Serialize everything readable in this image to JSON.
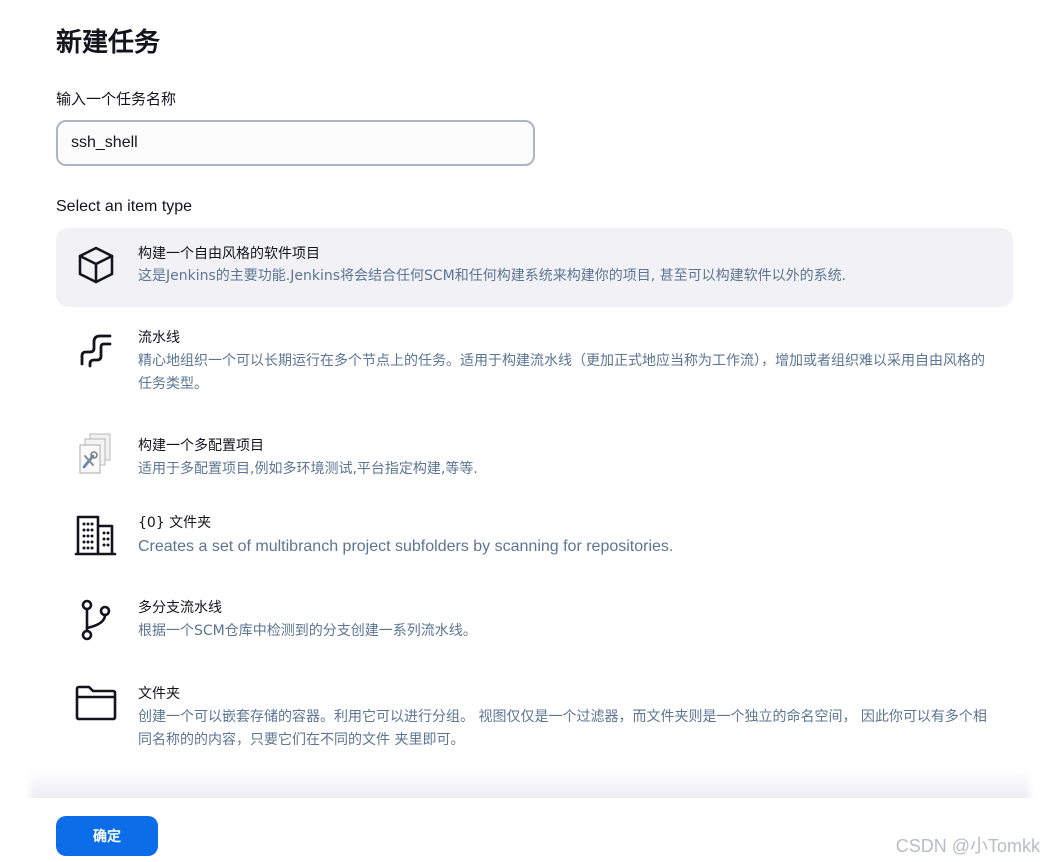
{
  "page": {
    "title": "新建任务"
  },
  "name_field": {
    "label": "输入一个任务名称",
    "value": "ssh_shell"
  },
  "item_types": {
    "label": "Select an item type",
    "items": [
      {
        "icon": "cube-icon",
        "title": "构建一个自由风格的软件项目",
        "description": "这是Jenkins的主要功能.Jenkins将会结合任何SCM和任何构建系统来构建你的项目, 甚至可以构建软件以外的系统.",
        "selected": true
      },
      {
        "icon": "pipeline-icon",
        "title": "流水线",
        "description": "精心地组织一个可以长期运行在多个节点上的任务。适用于构建流水线（更加正式地应当称为工作流），增加或者组织难以采用自由风格的任务类型。",
        "selected": false
      },
      {
        "icon": "multi-config-icon",
        "title": "构建一个多配置项目",
        "description": "适用于多配置项目,例如多环境测试,平台指定构建,等等.",
        "selected": false
      },
      {
        "icon": "organization-folder-icon",
        "title": "{0} 文件夹",
        "description": "Creates a set of multibranch project subfolders by scanning for repositories.",
        "selected": false
      },
      {
        "icon": "branch-icon",
        "title": "多分支流水线",
        "description": "根据一个SCM仓库中检测到的分支创建一系列流水线。",
        "selected": false
      },
      {
        "icon": "folder-icon",
        "title": "文件夹",
        "description": "创建一个可以嵌套存储的容器。利用它可以进行分组。 视图仅仅是一个过滤器，而文件夹则是一个独立的命名空间， 因此你可以有多个相同名称的的内容，只要它们在不同的文件 夹里即可。",
        "selected": false
      }
    ]
  },
  "footer": {
    "ok_label": "确定",
    "watermark": "CSDN @小Tomkk"
  },
  "colors": {
    "accent": "#0b6ee8",
    "selected_bg": "#f2f2f6",
    "description_text": "#5c7594"
  }
}
